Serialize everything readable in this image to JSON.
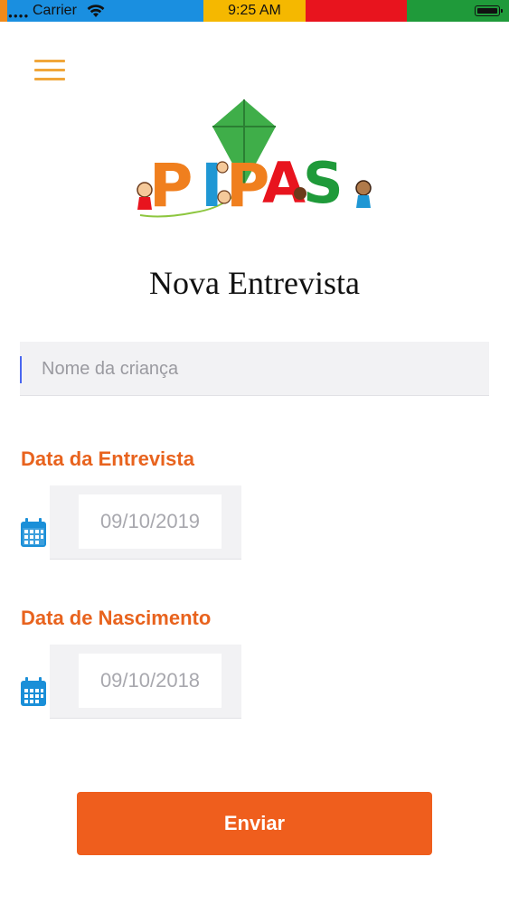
{
  "status_bar": {
    "carrier": "Carrier",
    "time": "9:25 AM",
    "colors": [
      "#1a8fe0",
      "#f5b800",
      "#e8141e",
      "#1f9a3a"
    ]
  },
  "menu": {
    "icon": "hamburger-menu-icon"
  },
  "logo": {
    "text": "PIPAS"
  },
  "form": {
    "title": "Nova Entrevista",
    "name_placeholder": "Nome da criança",
    "name_value": "",
    "interview_date_label": "Data da Entrevista",
    "interview_date_value": "09/10/2019",
    "birth_date_label": "Data de Nascimento",
    "birth_date_value": "09/10/2018",
    "calendar_icon": "calendar-icon",
    "submit_label": "Enviar"
  },
  "colors": {
    "accent": "#e8631e",
    "button": "#ef5e1d",
    "menu_icon": "#f0a63a",
    "calendar_icon": "#1a8fd8",
    "field_bg": "#f2f2f4"
  }
}
